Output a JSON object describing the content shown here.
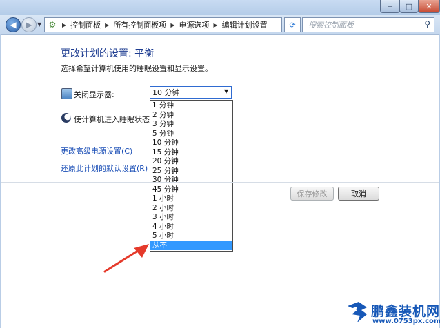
{
  "window": {
    "min_glyph": "─",
    "max_glyph": "□",
    "close_glyph": "✕"
  },
  "nav": {
    "back_glyph": "◀",
    "forward_glyph": "▶",
    "breadcrumbs": [
      "控制面板",
      "所有控制面板项",
      "电源选项",
      "编辑计划设置"
    ],
    "search_placeholder": "搜索控制面板"
  },
  "page": {
    "heading": "更改计划的设置: 平衡",
    "subheading": "选择希望计算机使用的睡眠设置和显示设置。"
  },
  "settings": {
    "display_off": {
      "label": "关闭显示器:",
      "value": "10 分钟",
      "icon": "monitor-icon"
    },
    "sleep": {
      "label": "使计算机进入睡眠状态:",
      "icon": "moon-icon"
    }
  },
  "dropdown": {
    "options": [
      "1 分钟",
      "2 分钟",
      "3 分钟",
      "5 分钟",
      "10 分钟",
      "15 分钟",
      "20 分钟",
      "25 分钟",
      "30 分钟",
      "45 分钟",
      "1 小时",
      "2 小时",
      "3 小时",
      "4 小时",
      "5 小时",
      "从不"
    ],
    "highlighted": "从不"
  },
  "links": {
    "advanced": "更改高级电源设置(C)",
    "restore": "还原此计划的默认设置(R)"
  },
  "buttons": {
    "save": "保存修改",
    "cancel": "取消"
  },
  "watermark": {
    "title": "鹏鑫装机网",
    "url": "www.0753px.com"
  },
  "colors": {
    "accent": "#3399ff",
    "link": "#1a4eb6",
    "heading": "#1e3d91",
    "arrow": "#e53a2b"
  }
}
